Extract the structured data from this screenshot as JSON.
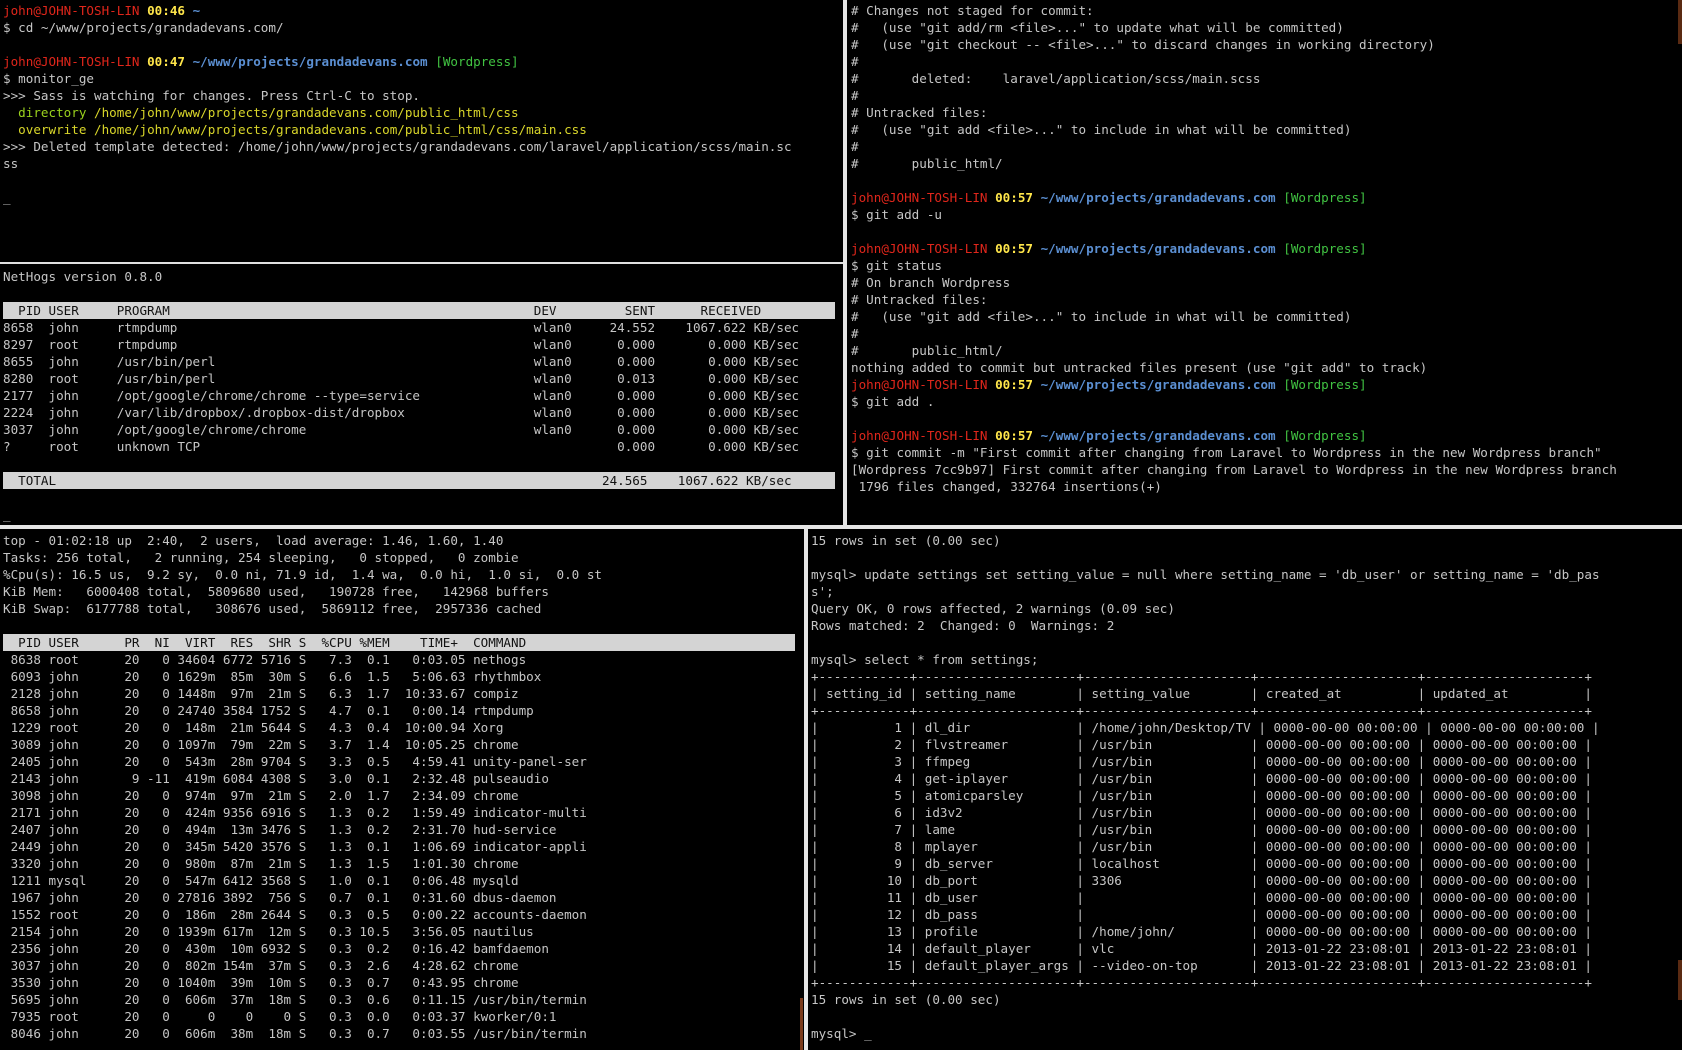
{
  "prompt": {
    "user": "john@JOHN-TOSH-LIN",
    "ps1": "$ "
  },
  "pane_top_left": {
    "lines": [
      {
        "time": "00:46",
        "path": "~",
        "branch": ""
      },
      {
        "cmd": "$ cd ~/www/projects/grandadevans.com/"
      },
      {
        "blank": ""
      },
      {
        "time": "00:47",
        "path": "~/www/projects/grandadevans.com",
        "branch": "[Wordpress]"
      },
      {
        "cmd": "$ monitor_ge"
      },
      {
        "text": ">>> Sass is watching for changes. Press Ctrl-C to stop."
      },
      {
        "green_label": "  directory",
        "text": " /home/john/www/projects/grandadevans.com/public_html/css"
      },
      {
        "yel_label": "  overwrite",
        "text": " /home/john/www/projects/grandadevans.com/public_html/css/main.css"
      },
      {
        "text": ">>> Deleted template detected: /home/john/www/projects/grandadevans.com/laravel/application/scss/main.sc"
      },
      {
        "text": "ss"
      },
      {
        "blank": ""
      },
      {
        "text": "_"
      }
    ]
  },
  "pane_nethogs": {
    "version": "NetHogs version 0.8.0",
    "header": "  PID USER     PROGRAM                                                DEV         SENT      RECEIVED       ",
    "rows": [
      "8658  john     rtmpdump                                               wlan0     24.552    1067.622 KB/sec",
      "8297  root     rtmpdump                                               wlan0      0.000       0.000 KB/sec",
      "8655  john     /usr/bin/perl                                          wlan0      0.000       0.000 KB/sec",
      "8280  root     /usr/bin/perl                                          wlan0      0.013       0.000 KB/sec",
      "2177  john     /opt/google/chrome/chrome --type=service               wlan0      0.000       0.000 KB/sec",
      "2224  john     /var/lib/dropbox/.dropbox-dist/dropbox                 wlan0      0.000       0.000 KB/sec",
      "3037  john     /opt/google/chrome/chrome                              wlan0      0.000       0.000 KB/sec",
      "?     root     unknown TCP                                                       0.000       0.000 KB/sec"
    ],
    "total": "  TOTAL                                                                        24.565    1067.622 KB/sec ",
    "cursor": "_"
  },
  "pane_git": {
    "lines": [
      {
        "text": "# Changes not staged for commit:"
      },
      {
        "text": "#   (use \"git add/rm <file>...\" to update what will be committed)"
      },
      {
        "text": "#   (use \"git checkout -- <file>...\" to discard changes in working directory)"
      },
      {
        "text": "#"
      },
      {
        "text": "#       deleted:    laravel/application/scss/main.scss"
      },
      {
        "text": "#"
      },
      {
        "text": "# Untracked files:"
      },
      {
        "text": "#   (use \"git add <file>...\" to include in what will be committed)"
      },
      {
        "text": "#"
      },
      {
        "text": "#       public_html/"
      },
      {
        "blank": ""
      },
      {
        "time": "00:57",
        "path": "~/www/projects/grandadevans.com",
        "branch": "[Wordpress]"
      },
      {
        "cmd": "$ git add -u"
      },
      {
        "blank": ""
      },
      {
        "time": "00:57",
        "path": "~/www/projects/grandadevans.com",
        "branch": "[Wordpress]"
      },
      {
        "cmd": "$ git status"
      },
      {
        "text": "# On branch Wordpress"
      },
      {
        "text": "# Untracked files:"
      },
      {
        "text": "#   (use \"git add <file>...\" to include in what will be committed)"
      },
      {
        "text": "#"
      },
      {
        "text": "#       public_html/"
      },
      {
        "text": "nothing added to commit but untracked files present (use \"git add\" to track)"
      },
      {
        "time": "00:57",
        "path": "~/www/projects/grandadevans.com",
        "branch": "[Wordpress]"
      },
      {
        "cmd": "$ git add ."
      },
      {
        "blank": ""
      },
      {
        "time": "00:57",
        "path": "~/www/projects/grandadevans.com",
        "branch": "[Wordpress]"
      },
      {
        "cmd": "$ git commit -m \"First commit after changing from Laravel to Wordpress in the new Wordpress branch\""
      },
      {
        "text": "[Wordpress 7cc9b97] First commit after changing from Laravel to Wordpress in the new Wordpress branch"
      },
      {
        "text": " 1796 files changed, 332764 insertions(+)"
      }
    ]
  },
  "pane_top": {
    "summary": [
      "top - 01:02:18 up  2:40,  2 users,  load average: 1.46, 1.60, 1.40",
      "Tasks: 256 total,   2 running, 254 sleeping,   0 stopped,   0 zombie",
      "%Cpu(s): 16.5 us,  9.2 sy,  0.0 ni, 71.9 id,  1.4 wa,  0.0 hi,  1.0 si,  0.0 st",
      "KiB Mem:   6000408 total,  5809680 used,   190728 free,   142968 buffers",
      "KiB Swap:  6177788 total,   308676 used,  5869112 free,  2957336 cached"
    ],
    "header": "  PID USER      PR  NI  VIRT  RES  SHR S  %CPU %MEM    TIME+  COMMAND          ",
    "rows": [
      " 8638 root      20   0 34604 6772 5716 S   7.3  0.1   0:03.05 nethogs",
      " 6093 john      20   0 1629m  85m  30m S   6.6  1.5   5:06.63 rhythmbox",
      " 2128 john      20   0 1448m  97m  21m S   6.3  1.7  10:33.67 compiz",
      " 8658 john      20   0 24740 3584 1752 S   4.7  0.1   0:00.14 rtmpdump",
      " 1229 root      20   0  148m  21m 5644 S   4.3  0.4  10:00.94 Xorg",
      " 3089 john      20   0 1097m  79m  22m S   3.7  1.4  10:05.25 chrome",
      " 2405 john      20   0  543m  28m 9704 S   3.3  0.5   4:59.41 unity-panel-ser",
      " 2143 john       9 -11  419m 6084 4308 S   3.0  0.1   2:32.48 pulseaudio",
      " 3098 john      20   0  974m  97m  21m S   2.0  1.7   2:34.09 chrome",
      " 2171 john      20   0  424m 9356 6916 S   1.3  0.2   1:59.49 indicator-multi",
      " 2407 john      20   0  494m  13m 3476 S   1.3  0.2   2:31.70 hud-service",
      " 2449 john      20   0  345m 5420 3576 S   1.3  0.1   1:06.69 indicator-appli",
      " 3320 john      20   0  980m  87m  21m S   1.3  1.5   1:01.30 chrome",
      " 1211 mysql     20   0  547m 6412 3568 S   1.0  0.1   0:06.48 mysqld",
      " 1967 john      20   0 27816 3892  756 S   0.7  0.1   0:31.60 dbus-daemon",
      " 1552 root      20   0  186m  28m 2644 S   0.3  0.5   0:00.22 accounts-daemon",
      " 2154 john      20   0 1939m 617m  12m S   0.3 10.5   3:56.05 nautilus",
      " 2356 john      20   0  430m  10m 6932 S   0.3  0.2   0:16.42 bamfdaemon",
      " 3037 john      20   0  802m 154m  37m S   0.3  2.6   4:28.62 chrome",
      " 3530 john      20   0 1040m  39m  10m S   0.3  0.7   0:43.95 chrome",
      " 5695 john      20   0  606m  37m  18m S   0.3  0.6   0:11.15 /usr/bin/termin",
      " 7935 root      20   0     0    0    0 S   0.3  0.0   0:03.37 kworker/0:1",
      " 8046 john      20   0  606m  38m  18m S   0.3  0.7   0:03.55 /usr/bin/termin"
    ]
  },
  "pane_mysql": {
    "lines": [
      "15 rows in set (0.00 sec)",
      "",
      "mysql> update settings set setting_value = null where setting_name = 'db_user' or setting_name = 'db_pas",
      "s';",
      "Query OK, 0 rows affected, 2 warnings (0.09 sec)",
      "Rows matched: 2  Changed: 0  Warnings: 2",
      "",
      "mysql> select * from settings;",
      "+------------+---------------------+----------------------+---------------------+---------------------+",
      "| setting_id | setting_name        | setting_value        | created_at          | updated_at          |",
      "+------------+---------------------+----------------------+---------------------+---------------------+",
      "|          1 | dl_dir              | /home/john/Desktop/TV | 0000-00-00 00:00:00 | 0000-00-00 00:00:00 |",
      "|          2 | flvstreamer         | /usr/bin             | 0000-00-00 00:00:00 | 0000-00-00 00:00:00 |",
      "|          3 | ffmpeg              | /usr/bin             | 0000-00-00 00:00:00 | 0000-00-00 00:00:00 |",
      "|          4 | get-iplayer         | /usr/bin             | 0000-00-00 00:00:00 | 0000-00-00 00:00:00 |",
      "|          5 | atomicparsley       | /usr/bin             | 0000-00-00 00:00:00 | 0000-00-00 00:00:00 |",
      "|          6 | id3v2               | /usr/bin             | 0000-00-00 00:00:00 | 0000-00-00 00:00:00 |",
      "|          7 | lame                | /usr/bin             | 0000-00-00 00:00:00 | 0000-00-00 00:00:00 |",
      "|          8 | mplayer             | /usr/bin             | 0000-00-00 00:00:00 | 0000-00-00 00:00:00 |",
      "|          9 | db_server           | localhost            | 0000-00-00 00:00:00 | 0000-00-00 00:00:00 |",
      "|         10 | db_port             | 3306                 | 0000-00-00 00:00:00 | 0000-00-00 00:00:00 |",
      "|         11 | db_user             |                      | 0000-00-00 00:00:00 | 0000-00-00 00:00:00 |",
      "|         12 | db_pass             |                      | 0000-00-00 00:00:00 | 0000-00-00 00:00:00 |",
      "|         13 | profile             | /home/john/          | 0000-00-00 00:00:00 | 0000-00-00 00:00:00 |",
      "|         14 | default_player      | vlc                  | 2013-01-22 23:08:01 | 2013-01-22 23:08:01 |",
      "|         15 | default_player_args | --video-on-top       | 2013-01-22 23:08:01 | 2013-01-22 23:08:01 |",
      "+------------+---------------------+----------------------+---------------------+---------------------+",
      "15 rows in set (0.00 sec)",
      "",
      "mysql> _"
    ]
  }
}
